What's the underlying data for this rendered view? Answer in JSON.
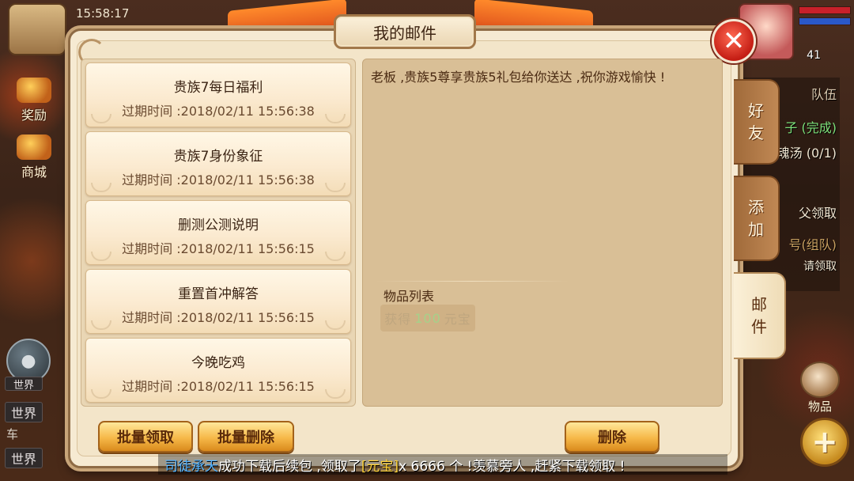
{
  "status_bar": {
    "time": "15:58:17"
  },
  "left_hud": {
    "reward_label": "奖励",
    "shop_label": "商城",
    "world_tag": "世界",
    "world_tag_2": "世界",
    "world_tag_3": "世界",
    "car_text": "车"
  },
  "right_hud": {
    "level": "41",
    "team_tab": "队伍",
    "quest_lines": [
      "子 (完成)",
      "魂汤 (0/1)",
      "父领取",
      "号(组队)",
      "请领取"
    ],
    "goods_label": "物品",
    "plus_symbol": "+"
  },
  "dialog": {
    "title": "我的邮件",
    "close_symbol": "✕",
    "mails": [
      {
        "subject": "贵族7每日福利",
        "expiry": "过期时间 :2018/02/11 15:56:38"
      },
      {
        "subject": "贵族7身份象征",
        "expiry": "过期时间 :2018/02/11 15:56:38"
      },
      {
        "subject": "删测公测说明",
        "expiry": "过期时间 :2018/02/11 15:56:15"
      },
      {
        "subject": "重置首冲解答",
        "expiry": "过期时间 :2018/02/11 15:56:15"
      },
      {
        "subject": "今晚吃鸡",
        "expiry": "过期时间 :2018/02/11 15:56:15"
      }
    ],
    "selected_mail": {
      "body": "老板 ,贵族5尊享贵族5礼包给你送达 ,祝你游戏愉快 !",
      "items_label": "物品列表",
      "reward_prefix": "获得",
      "reward_amount": "100",
      "reward_unit": "元宝"
    },
    "buttons": {
      "batch_claim": "批量领取",
      "batch_delete": "批量删除",
      "delete": "删除"
    },
    "side_tabs": [
      {
        "label_1": "好",
        "label_2": "友",
        "active": false
      },
      {
        "label_1": "添",
        "label_2": "加",
        "active": false
      },
      {
        "label_1": "邮",
        "label_2": "件",
        "active": true
      }
    ]
  },
  "ticker": {
    "player_name": "司徒承天",
    "text_1": "成功下载后续包 ,领取了",
    "item": "[元宝]",
    "text_2": "x 6666 个 !羡慕旁人 ,赶紧下载领取 !"
  },
  "colors": {
    "accent_orange": "#f6b848",
    "close_red": "#c41d14",
    "player_name_blue": "#56b4ff",
    "item_yellow": "#ffd23a"
  }
}
